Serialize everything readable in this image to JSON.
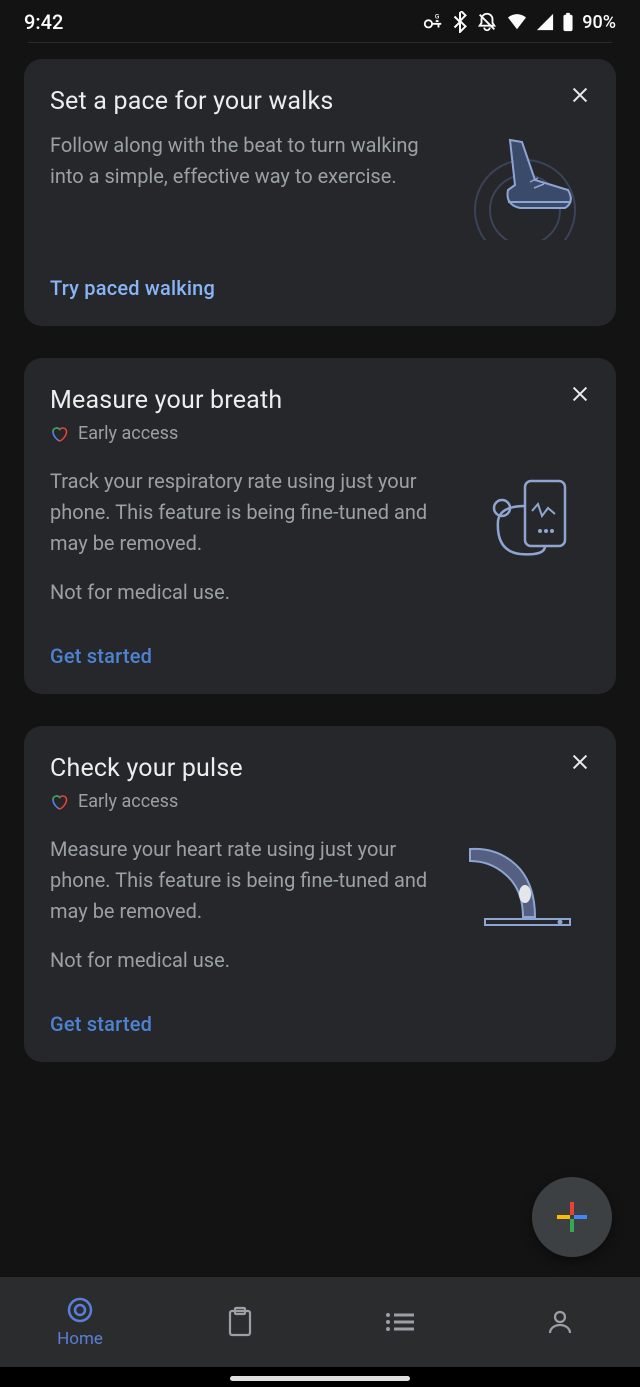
{
  "status": {
    "time": "9:42",
    "battery": "90%"
  },
  "cards": [
    {
      "title": "Set a pace for your walks",
      "desc": "Follow along with the beat to turn walking into a simple, effective way to exercise.",
      "action": "Try paced walking",
      "early_access": false
    },
    {
      "title": "Measure your breath",
      "early_access": true,
      "badge": "Early access",
      "desc": "Track your respiratory rate using just your phone. This feature is being fine-tuned and may be removed.",
      "note": "Not for medical use.",
      "action": "Get started"
    },
    {
      "title": "Check your pulse",
      "early_access": true,
      "badge": "Early access",
      "desc": "Measure your heart rate using just your phone. This feature is being fine-tuned and may be removed.",
      "note": "Not for medical use.",
      "action": "Get started"
    }
  ],
  "nav": {
    "home": "Home"
  }
}
